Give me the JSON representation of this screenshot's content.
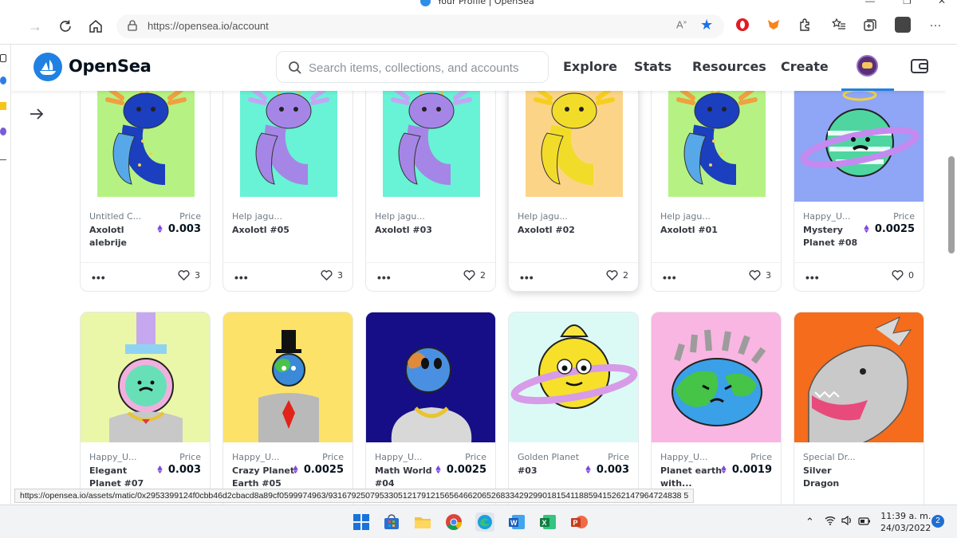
{
  "window": {
    "title": "Your Profile | OpenSea",
    "controls": [
      "—",
      "❐",
      "✕"
    ]
  },
  "browser": {
    "url": "https://opensea.io/account",
    "read_aloud": "Ȃ",
    "status_url": "https://opensea.io/assets/matic/0x2953399124f0cbb46d2cbacd8a89cf0599974963/9316792507953305121791215656466206526833429299018154118859415262147964724838 5"
  },
  "header": {
    "brand": "OpenSea",
    "search_placeholder": "Search items, collections, and accounts",
    "nav": [
      "Explore",
      "Stats",
      "Resources",
      "Create"
    ]
  },
  "cards_row1": [
    {
      "collection": "Untitled C...",
      "name_line1": "Axolotl",
      "name_line2": "alebrije",
      "price_label": "Price",
      "price": "0.003",
      "likes": "3",
      "bg": "#b5f283",
      "img_bg": "#b5f283",
      "kind": "axolotl-blue"
    },
    {
      "collection": "Help jagu...",
      "name_line1": "Axolotl #05",
      "name_line2": "",
      "price_label": "",
      "price": "",
      "likes": "3",
      "bg": "#68f2d6",
      "img_bg": "#68f2d6",
      "kind": "axolotl-purple"
    },
    {
      "collection": "Help jagu...",
      "name_line1": "Axolotl #03",
      "name_line2": "",
      "price_label": "",
      "price": "",
      "likes": "2",
      "bg": "#68f2d6",
      "img_bg": "#68f2d6",
      "kind": "axolotl-purple"
    },
    {
      "collection": "Help jagu...",
      "name_line1": "Axolotl #02",
      "name_line2": "",
      "price_label": "",
      "price": "",
      "likes": "2",
      "bg": "#fcd488",
      "img_bg": "#fcd488",
      "kind": "axolotl-yellow"
    },
    {
      "collection": "Help jagu...",
      "name_line1": "Axolotl #01",
      "name_line2": "",
      "price_label": "",
      "price": "",
      "likes": "3",
      "bg": "#b5f283",
      "img_bg": "#b5f283",
      "kind": "axolotl-blue"
    },
    {
      "collection": "Happy_U...",
      "name_line1": "Mystery",
      "name_line2": "Planet #08",
      "price_label": "Price",
      "price": "0.0025",
      "likes": "0",
      "bg": "#8fa5f5",
      "img_bg": "#8fa5f5",
      "kind": "planet-green"
    }
  ],
  "cards_row2": [
    {
      "collection": "Happy_U...",
      "name_line1": "Elegant",
      "name_line2": "Planet #07",
      "price_label": "Price",
      "price": "0.003",
      "bg": "#eaf7a8",
      "kind": "elegant"
    },
    {
      "collection": "Happy_U...",
      "name_line1": "Crazy Planet",
      "name_line2": "Earth #05",
      "price_label": "Price",
      "price": "0.0025",
      "bg": "#fde26a",
      "kind": "crazy"
    },
    {
      "collection": "Happy_U...",
      "name_line1": "Math World",
      "name_line2": "#04",
      "price_label": "Price",
      "price": "0.0025",
      "bg": "#160e86",
      "kind": "math"
    },
    {
      "collection": "Golden Planet",
      "name_line1": "#03",
      "name_line2": "",
      "price_label": "Price",
      "price": "0.003",
      "bg": "#dcfaf5",
      "kind": "golden"
    },
    {
      "collection": "Happy_U...",
      "name_line1": "Planet earth",
      "name_line2": "with...",
      "price_label": "Price",
      "price": "0.0019",
      "bg": "#f9b6e2",
      "kind": "earth"
    },
    {
      "collection": "Special Dr...",
      "name_line1": "Silver Dragon",
      "name_line2": "",
      "price_label": "",
      "price": "",
      "bg": "#f46c1c",
      "kind": "dragon"
    }
  ],
  "taskbar": {
    "time": "11:39 a. m.",
    "date": "24/03/2022",
    "notifications": "2",
    "apps": [
      "windows-start",
      "store",
      "file-explorer",
      "chrome",
      "edge",
      "word",
      "excel",
      "powerpoint"
    ]
  },
  "colors": {
    "brand": "#2081e2",
    "eth_purple": "#8247e5"
  }
}
